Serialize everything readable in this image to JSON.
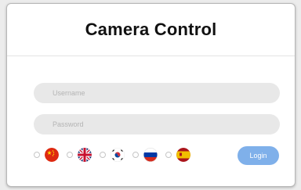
{
  "header": {
    "title": "Camera Control"
  },
  "form": {
    "username_placeholder": "Username",
    "password_placeholder": "Password",
    "login_label": "Login"
  },
  "languages": [
    {
      "name": "china-flag-icon"
    },
    {
      "name": "uk-flag-icon"
    },
    {
      "name": "korea-flag-icon"
    },
    {
      "name": "russia-flag-icon"
    },
    {
      "name": "spain-flag-icon"
    }
  ],
  "colors": {
    "accent": "#7fb0ea",
    "field_bg": "#e8e8e8"
  }
}
